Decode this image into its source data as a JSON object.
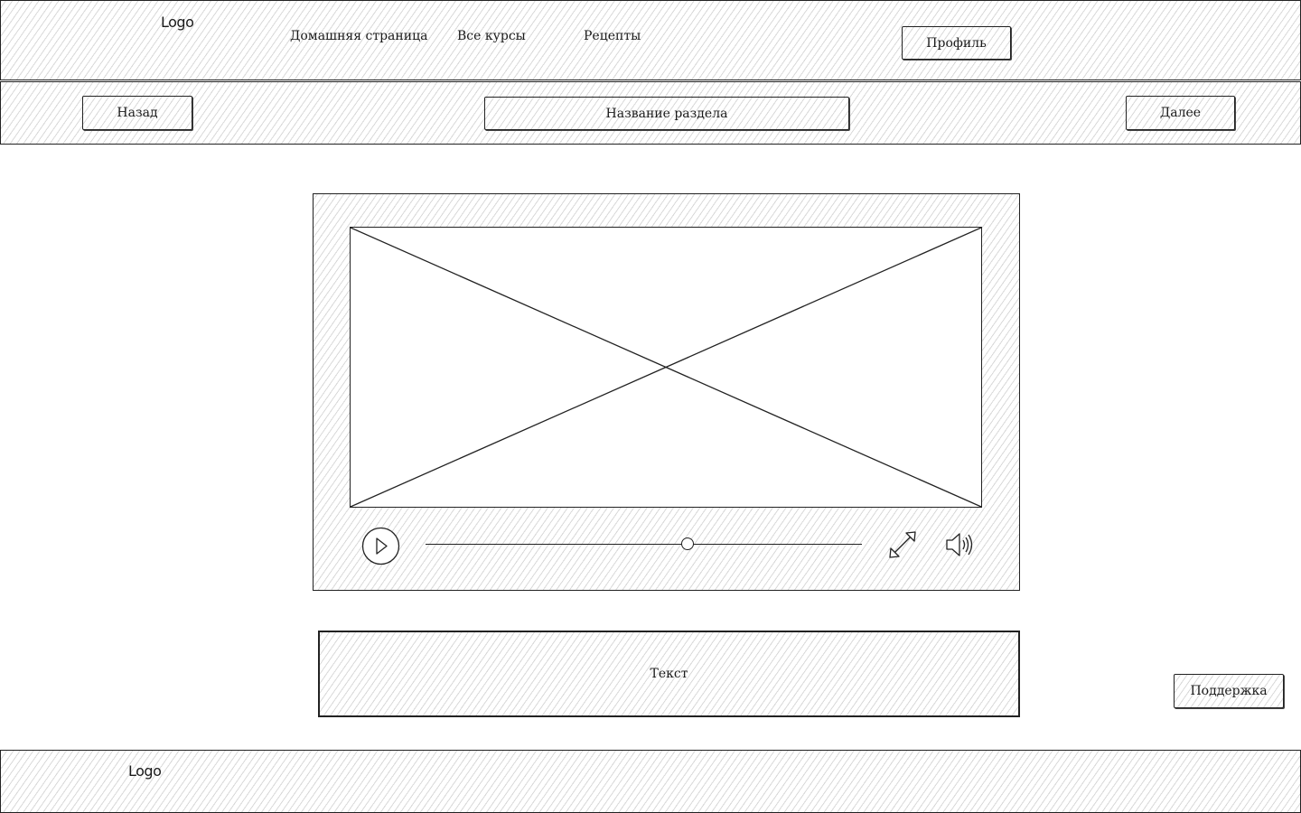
{
  "header": {
    "logo": "Logo",
    "nav": [
      "Домашняя страница",
      "Все курсы",
      "Рецепты"
    ],
    "profile_button": "Профиль"
  },
  "section_bar": {
    "back_button": "Назад",
    "title": "Название раздела",
    "next_button": "Далее"
  },
  "video_player": {
    "progress": 0.6
  },
  "text_block": {
    "text": "Текст"
  },
  "support_button": "Поддержка",
  "footer": {
    "logo": "Logo"
  }
}
